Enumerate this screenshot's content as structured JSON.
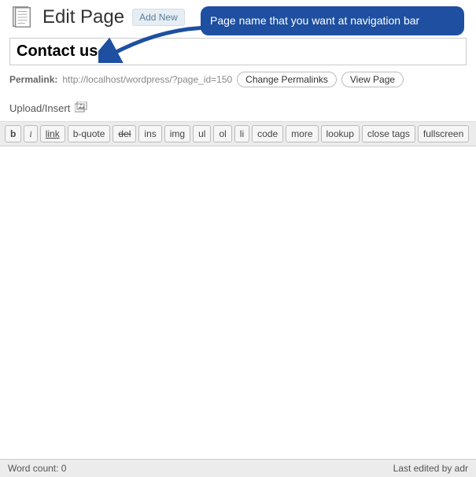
{
  "header": {
    "title": "Edit Page",
    "add_new_label": "Add New"
  },
  "callout": {
    "text": "Page name that you want at navigation bar"
  },
  "page_title_input": {
    "value": "Contact us"
  },
  "permalink": {
    "label": "Permalink:",
    "url": "http://localhost/wordpress/?page_id=150",
    "change_btn": "Change Permalinks",
    "view_btn": "View Page"
  },
  "upload": {
    "label": "Upload/Insert"
  },
  "toolbar": {
    "buttons": [
      "b",
      "i",
      "link",
      "b-quote",
      "del",
      "ins",
      "img",
      "ul",
      "ol",
      "li",
      "code",
      "more",
      "lookup",
      "close tags",
      "fullscreen"
    ]
  },
  "editor": {
    "content": ""
  },
  "footer": {
    "word_count_label": "Word count: 0",
    "last_edited": "Last edited by adr"
  }
}
